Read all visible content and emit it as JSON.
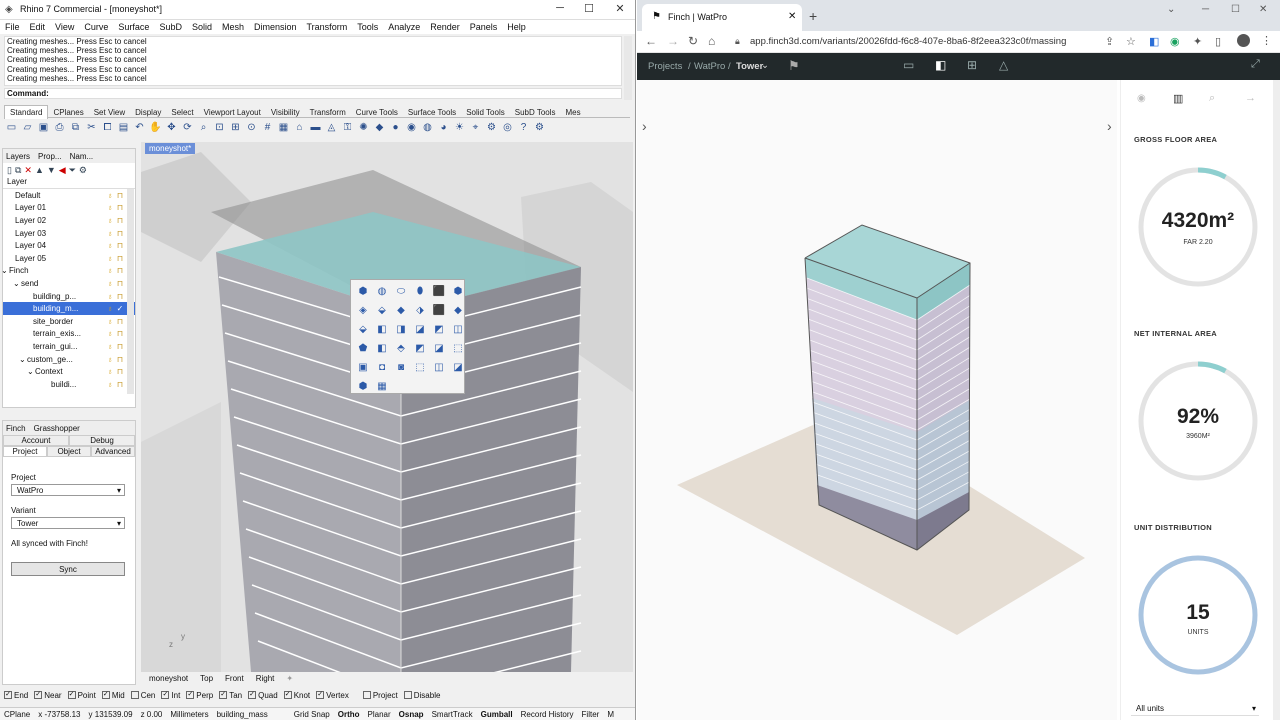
{
  "rhino": {
    "title": "Rhino 7 Commercial - [moneyshot*]",
    "menu": [
      "File",
      "Edit",
      "View",
      "Curve",
      "Surface",
      "SubD",
      "Solid",
      "Mesh",
      "Dimension",
      "Transform",
      "Tools",
      "Analyze",
      "Render",
      "Panels",
      "Help"
    ],
    "command_history": [
      "Creating meshes... Press Esc to cancel",
      "Creating meshes... Press Esc to cancel",
      "Creating meshes... Press Esc to cancel",
      "Creating meshes... Press Esc to cancel",
      "Creating meshes... Press Esc to cancel"
    ],
    "command_label": "Command:",
    "toolbar_tabs": [
      "Standard",
      "CPlanes",
      "Set View",
      "Display",
      "Select",
      "Viewport Layout",
      "Visibility",
      "Transform",
      "Curve Tools",
      "Surface Tools",
      "Solid Tools",
      "SubD Tools",
      "Mes"
    ],
    "panel_tabs": [
      "Layers",
      "Prop...",
      "Nam..."
    ],
    "layer_header": "Layer",
    "layers": [
      "Default",
      "Layer 01",
      "Layer 02",
      "Layer 03",
      "Layer 04",
      "Layer 05",
      "Finch",
      "send",
      "building_p...",
      "building_m...",
      "site_border",
      "terrain_exis...",
      "terrain_gui...",
      "custom_ge...",
      "Context",
      "buildi..."
    ],
    "finch_tabs": [
      "Finch",
      "Grasshopper"
    ],
    "finch_subtabs_top": [
      "Account",
      "Debug"
    ],
    "finch_subtabs": [
      "Project",
      "Object",
      "Advanced"
    ],
    "project_label": "Project",
    "project_value": "WatPro",
    "variant_label": "Variant",
    "variant_value": "Tower",
    "sync_status": "All synced with Finch!",
    "sync_button": "Sync",
    "viewport_name": "moneyshot*",
    "viewport_tabs": [
      "moneyshot",
      "Top",
      "Front",
      "Right"
    ],
    "osnaps": [
      "End",
      "Near",
      "Point",
      "Mid",
      "Cen",
      "Int",
      "Perp",
      "Tan",
      "Quad",
      "Knot",
      "Vertex",
      "Project",
      "Disable"
    ],
    "osnaps_checked": [
      true,
      true,
      true,
      true,
      false,
      true,
      true,
      true,
      true,
      true,
      true,
      false,
      false
    ],
    "status": {
      "cplane": "CPlane",
      "x": "x -73758.13",
      "y": "y 131539.09",
      "z": "z 0.00",
      "units": "Millimeters",
      "layer": "building_mass",
      "items": [
        "Grid Snap",
        "Ortho",
        "Planar",
        "Osnap",
        "SmartTrack",
        "Gumball",
        "Record History",
        "Filter",
        "M"
      ]
    }
  },
  "browser": {
    "tab_title": "Finch | WatPro",
    "url": "app.finch3d.com/variants/20026fdd-f6c8-407e-8ba6-8f2eea323c0f/massing",
    "breadcrumb": [
      "Projects",
      "/",
      "WatPro",
      "/",
      "Tower"
    ]
  },
  "finch": {
    "gfa": {
      "label": "GROSS FLOOR AREA",
      "value": "4320m²",
      "sub": "FAR 2.20",
      "fraction": 0.08
    },
    "nia": {
      "label": "NET INTERNAL AREA",
      "value": "92%",
      "sub": "3960M²",
      "fraction": 0.08
    },
    "units": {
      "label": "UNIT DISTRIBUTION",
      "value": "15",
      "sub": "UNITS"
    },
    "filter": "All units"
  },
  "colors": {
    "accent": "#8ecfcf",
    "finch_bar": "#22292b",
    "selection": "#3a6fd8"
  }
}
